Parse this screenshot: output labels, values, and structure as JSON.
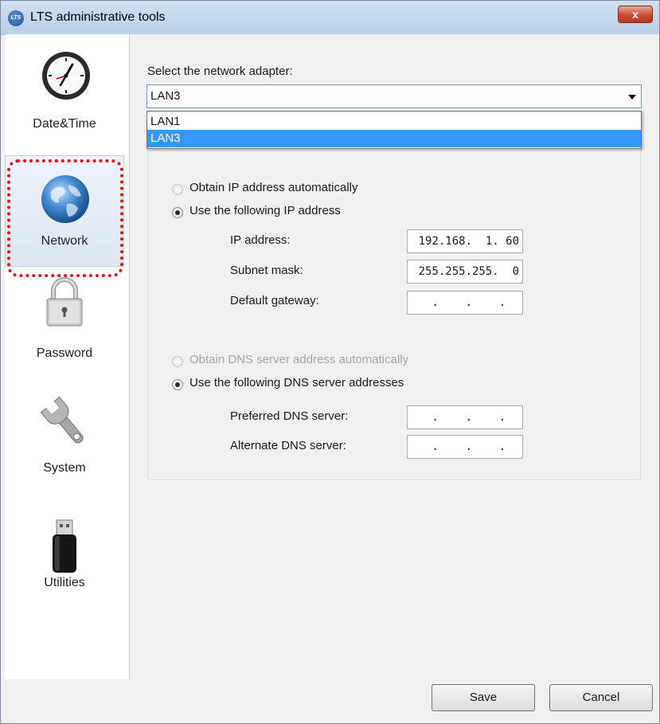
{
  "window": {
    "title": "LTS administrative tools",
    "app_icon_text": "LTS",
    "close_label": "x"
  },
  "sidebar": {
    "items": [
      {
        "label": "Date&Time",
        "icon": "clock-icon"
      },
      {
        "label": "Network",
        "icon": "globe-icon",
        "active": true
      },
      {
        "label": "Password",
        "icon": "padlock-icon"
      },
      {
        "label": "System",
        "icon": "wrench-icon"
      },
      {
        "label": "Utilities",
        "icon": "usb-drive-icon"
      }
    ]
  },
  "adapter": {
    "label": "Select the network adapter:",
    "selected": "LAN3",
    "options": [
      "LAN1",
      "LAN3"
    ]
  },
  "ip": {
    "auto_label": "Obtain IP address automatically",
    "manual_label": "Use the following IP address",
    "mode": "manual",
    "fields": [
      {
        "label": "IP address:",
        "value": "192.168.  1. 60"
      },
      {
        "label": "Subnet mask:",
        "value": "255.255.255.  0"
      },
      {
        "label": "Default gateway:",
        "value": "  .    .    .  "
      }
    ]
  },
  "dns": {
    "auto_label": "Obtain DNS server address automatically",
    "manual_label": "Use the following DNS server addresses",
    "mode": "manual",
    "fields": [
      {
        "label": "Preferred DNS server:",
        "value": "  .    .    .  "
      },
      {
        "label": "Alternate DNS server:",
        "value": "  .    .    .  "
      }
    ]
  },
  "buttons": {
    "save": "Save",
    "cancel": "Cancel"
  },
  "colors": {
    "highlight": "#d8111b",
    "selection": "#3399ff"
  }
}
